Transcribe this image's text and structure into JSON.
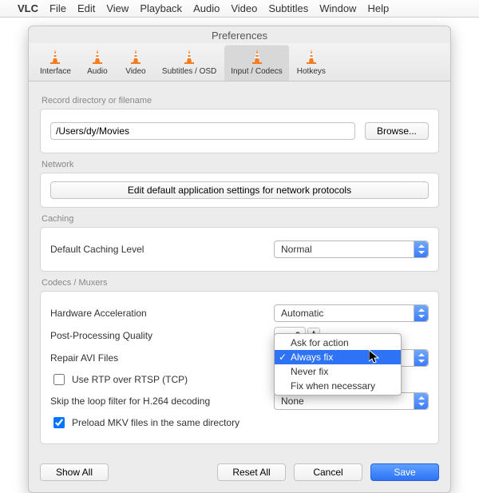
{
  "menubar": {
    "apple": "",
    "app": "VLC",
    "items": [
      "File",
      "Edit",
      "View",
      "Playback",
      "Audio",
      "Video",
      "Subtitles",
      "Window",
      "Help"
    ]
  },
  "window": {
    "title": "Preferences"
  },
  "tabs": [
    {
      "label": "Interface"
    },
    {
      "label": "Audio"
    },
    {
      "label": "Video"
    },
    {
      "label": "Subtitles / OSD"
    },
    {
      "label": "Input / Codecs"
    },
    {
      "label": "Hotkeys"
    }
  ],
  "record": {
    "group": "Record directory or filename",
    "path": "/Users/dy/Movies",
    "browse": "Browse..."
  },
  "network": {
    "group": "Network",
    "button": "Edit default application settings for network protocols"
  },
  "caching": {
    "group": "Caching",
    "label": "Default Caching Level",
    "value": "Normal"
  },
  "codecs": {
    "group": "Codecs / Muxers",
    "hwaccel_label": "Hardware Acceleration",
    "hwaccel_value": "Automatic",
    "ppq_label": "Post-Processing Quality",
    "ppq_value": "6",
    "repair_label": "Repair AVI Files",
    "repair_options": [
      "Ask for action",
      "Always fix",
      "Never fix",
      "Fix when necessary"
    ],
    "repair_selected": "Always fix",
    "rtp_label": "Use RTP over RTSP (TCP)",
    "rtp_checked": false,
    "skip_label": "Skip the loop filter for H.264 decoding",
    "skip_value": "None",
    "mkv_label": "Preload MKV files in the same directory",
    "mkv_checked": true
  },
  "footer": {
    "show_all": "Show All",
    "reset_all": "Reset All",
    "cancel": "Cancel",
    "save": "Save"
  }
}
